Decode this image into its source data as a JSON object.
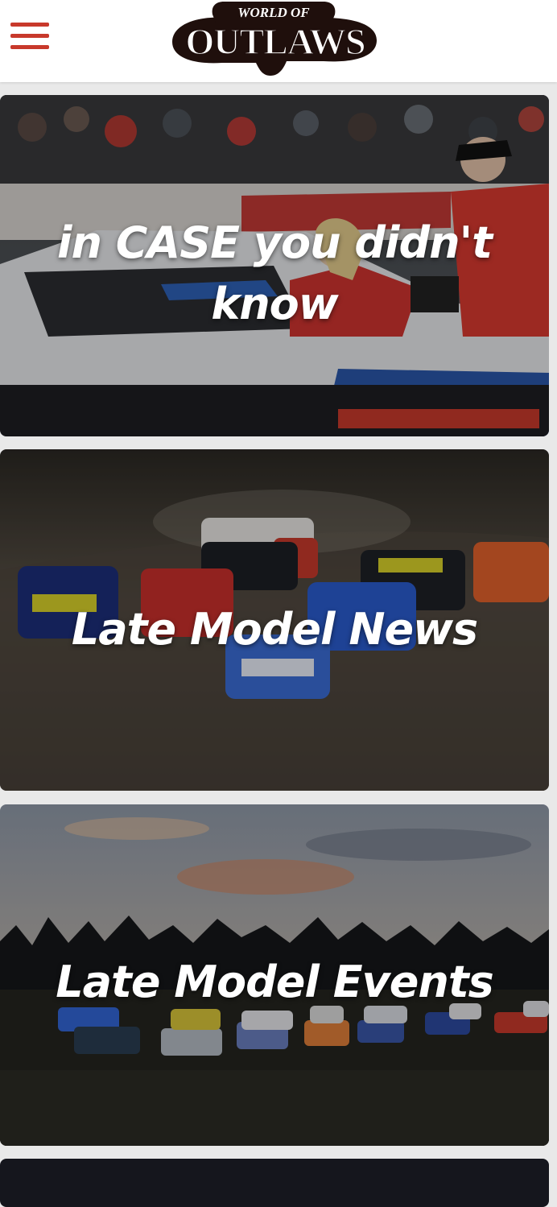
{
  "header": {
    "logo_text_top": "WORLD OF",
    "logo_text_main": "OUTLAWS",
    "menu_icon": "hamburger-menu-icon"
  },
  "colors": {
    "accent": "#c8392b",
    "logo_dark": "#1f0f0c",
    "logo_light": "#ffffff"
  },
  "cards": [
    {
      "title": "in CASE you didn't know"
    },
    {
      "title": "Late Model News"
    },
    {
      "title": "Late Model Events"
    }
  ]
}
